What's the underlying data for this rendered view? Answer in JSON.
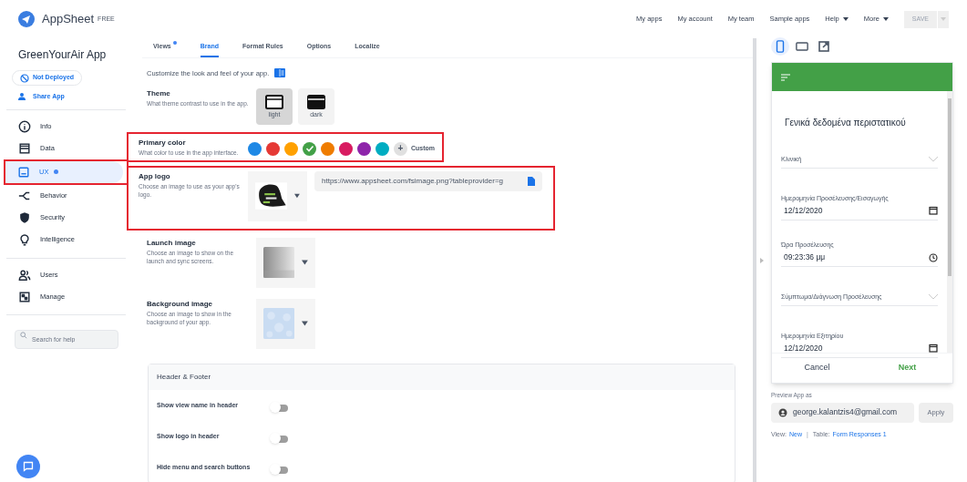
{
  "header": {
    "brand": "AppSheet",
    "plan": "FREE",
    "nav": [
      {
        "label": "My apps",
        "menu": false
      },
      {
        "label": "My account",
        "menu": false
      },
      {
        "label": "My team",
        "menu": false
      },
      {
        "label": "Sample apps",
        "menu": false
      },
      {
        "label": "Help",
        "menu": true
      },
      {
        "label": "More",
        "menu": true
      }
    ],
    "save": {
      "label": "SAVE",
      "disabled": true
    }
  },
  "sidebar": {
    "app_name": "GreenYourAir App",
    "status": "Not Deployed",
    "share": "Share App",
    "groups": [
      [
        {
          "label": "Info",
          "selected": false,
          "dot": false,
          "highlighted": false
        },
        {
          "label": "Data",
          "selected": false,
          "dot": false,
          "highlighted": false
        },
        {
          "label": "UX",
          "selected": true,
          "dot": true,
          "highlighted": true
        },
        {
          "label": "Behavior",
          "selected": false,
          "dot": false,
          "highlighted": false
        },
        {
          "label": "Security",
          "selected": false,
          "dot": false,
          "highlighted": false
        },
        {
          "label": "Intelligence",
          "selected": false,
          "dot": false,
          "highlighted": false
        }
      ],
      [
        {
          "label": "Users",
          "selected": false,
          "dot": false,
          "highlighted": false
        },
        {
          "label": "Manage",
          "selected": false,
          "dot": false,
          "highlighted": false
        }
      ]
    ],
    "search": {
      "placeholder": "Search for help"
    }
  },
  "tabs": [
    {
      "label": "Views",
      "selected": false,
      "dot": true
    },
    {
      "label": "Brand",
      "selected": true,
      "dot": false
    },
    {
      "label": "Format Rules",
      "selected": false,
      "dot": false
    },
    {
      "label": "Options",
      "selected": false,
      "dot": false
    },
    {
      "label": "Localize",
      "selected": false,
      "dot": false
    }
  ],
  "intro": "Customize the look and feel of your app.",
  "sections": [
    {
      "kind": "theme",
      "title": "Theme",
      "description": "What theme contrast to use in the app.",
      "highlighted": false,
      "options": [
        {
          "label": "light",
          "selected": true
        },
        {
          "label": "dark",
          "selected": false
        }
      ]
    },
    {
      "kind": "colors",
      "title": "Primary color",
      "description": "What color to use in the app interface.",
      "highlighted": true,
      "colors": [
        {
          "color": "#1e88e5",
          "selected": false
        },
        {
          "color": "#e53935",
          "selected": false
        },
        {
          "color": "#ffa000",
          "selected": false
        },
        {
          "color": "#43a047",
          "selected": true
        },
        {
          "color": "#ef7c00",
          "selected": false
        },
        {
          "color": "#d81b60",
          "selected": false
        },
        {
          "color": "#8e24aa",
          "selected": false
        },
        {
          "color": "#00acc1",
          "selected": false
        }
      ],
      "custom_icon": "+",
      "custom": "Custom"
    },
    {
      "kind": "logo",
      "title": "App logo",
      "description": "Choose an image to use as your app's logo.",
      "highlighted": true,
      "url": "https://www.appsheet.com/fsimage.png?tableprovider=g"
    },
    {
      "kind": "launch",
      "title": "Launch image",
      "description": "Choose an image to show on the launch and sync screens.",
      "highlighted": false
    },
    {
      "kind": "background",
      "title": "Background image",
      "description": "Choose an image to show in the background of your app.",
      "highlighted": false
    }
  ],
  "header_footer": {
    "title": "Header & Footer",
    "toggles": [
      {
        "label": "Show view name in header",
        "on": false
      },
      {
        "label": "Show logo in header",
        "on": false
      },
      {
        "label": "Hide menu and search buttons",
        "on": false
      }
    ]
  },
  "preview": {
    "devices": [
      {
        "kind": "phone",
        "selected": true
      },
      {
        "kind": "tablet",
        "selected": false
      },
      {
        "kind": "external",
        "selected": false
      }
    ],
    "form_title": "Γενικά δεδομένα περιστατικού",
    "fields": [
      {
        "kind": "dropdown",
        "label": "Κλινική"
      },
      {
        "kind": "date",
        "label": "Ημερομηνία Προσέλευσης/Εισαγωγής",
        "value": "12/12/2020"
      },
      {
        "kind": "time",
        "label": "Ώρα Προσέλευσης",
        "value": "09:23:36 μμ"
      },
      {
        "kind": "dropdown",
        "label": "Σύμπτωμα/Διάγνωση Προσέλευσης"
      },
      {
        "kind": "date",
        "label": "Ημερομηνία Εξιτηρίου",
        "value": "12/12/2020"
      }
    ],
    "cancel": "Cancel",
    "next": "Next",
    "preview_as_label": "Preview App as",
    "user": "george.kalantzis4@gmail.com",
    "apply": {
      "label": "Apply",
      "disabled": true
    },
    "view_label": "View:",
    "view": "New",
    "separator": "|",
    "table_label": "Table:",
    "table": "Form Responses 1"
  }
}
